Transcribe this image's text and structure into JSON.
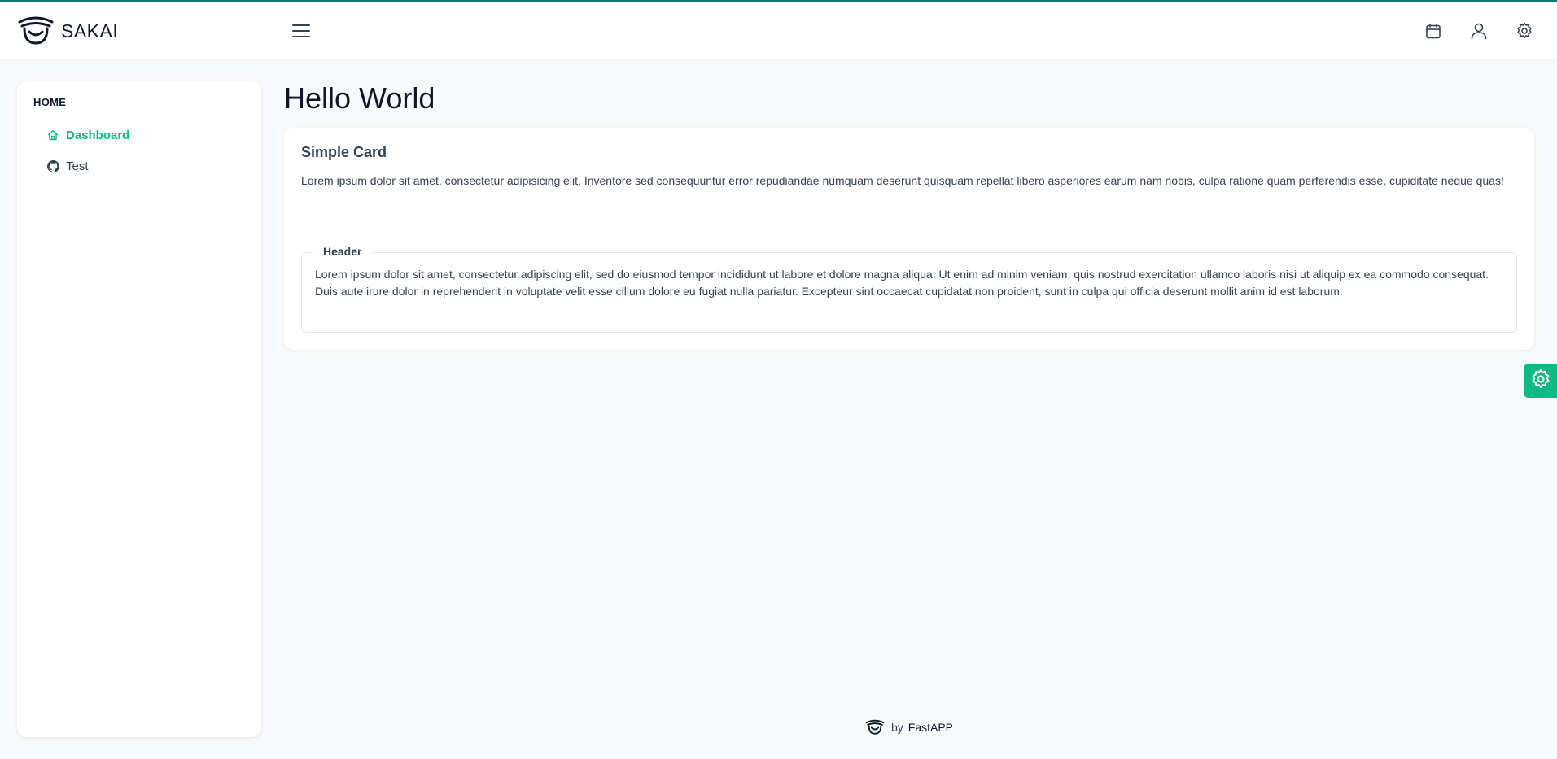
{
  "topbar": {
    "app_name": "SAKAI",
    "accent_color": "#0f766e",
    "icons": [
      "menu-icon",
      "calendar-icon",
      "user-icon",
      "settings-icon"
    ]
  },
  "sidebar": {
    "section_label": "HOME",
    "items": [
      {
        "label": "Dashboard",
        "icon": "home-icon",
        "active": true
      },
      {
        "label": "Test",
        "icon": "github-icon",
        "active": false
      }
    ],
    "active_color": "#10b981"
  },
  "main": {
    "page_title": "Hello World",
    "card": {
      "title": "Simple Card",
      "text": "Lorem ipsum dolor sit amet, consectetur adipisicing elit. Inventore sed consequuntur error repudiandae numquam deserunt quisquam repellat libero asperiores earum nam nobis, culpa ratione quam perferendis esse, cupiditate neque quas!",
      "fieldset": {
        "legend": "Header",
        "text": "Lorem ipsum dolor sit amet, consectetur adipiscing elit, sed do eiusmod tempor incididunt ut labore et dolore magna aliqua. Ut enim ad minim veniam, quis nostrud exercitation ullamco laboris nisi ut aliquip ex ea commodo consequat. Duis aute irure dolor in reprehenderit in voluptate velit esse cillum dolore eu fugiat nulla pariatur. Excepteur sint occaecat cupidatat non proident, sunt in culpa qui officia deserunt mollit anim id est laborum."
      }
    }
  },
  "config_button": {
    "icon": "gear-icon",
    "color": "#10b981"
  },
  "footer": {
    "by": "by",
    "brand": "FastAPP"
  }
}
